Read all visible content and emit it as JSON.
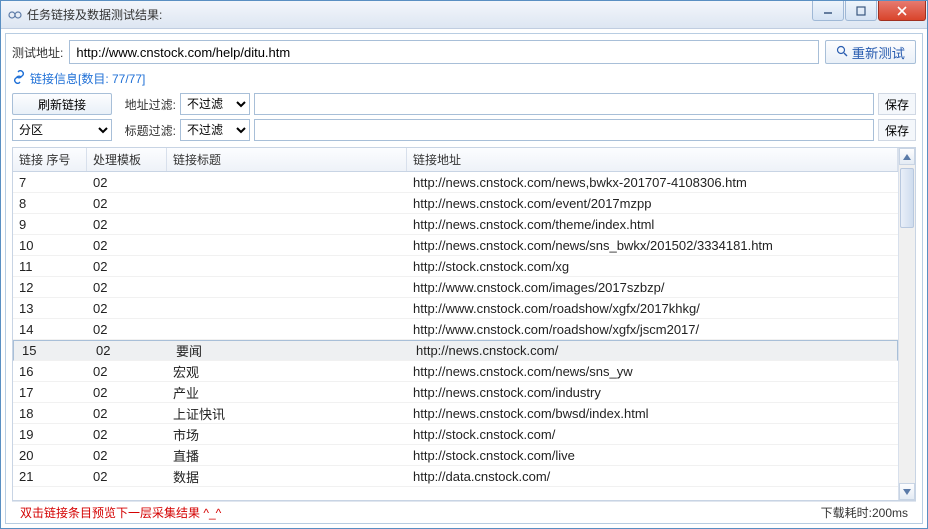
{
  "window": {
    "title": "任务链接及数据测试结果:"
  },
  "toolbar": {
    "test_url_label": "测试地址:",
    "test_url_value": "http://www.cnstock.com/help/ditu.htm",
    "retest_label": "重新测试"
  },
  "linkinfo": {
    "text": "链接信息[数目: 77/77]"
  },
  "filters": {
    "refresh_label": "刷新链接",
    "addr_filter_label": "地址过滤:",
    "title_filter_label": "标题过滤:",
    "no_filter_option": "不过滤",
    "partition_option": "分区",
    "addr_filter_value": "",
    "title_filter_value": "",
    "save_label": "保存"
  },
  "table": {
    "columns": {
      "seq": "链接 序号",
      "tmpl": "处理模板",
      "title": "链接标题",
      "url": "链接地址"
    },
    "rows": [
      {
        "seq": "7",
        "tmpl": "02",
        "title": "",
        "url": "http://news.cnstock.com/news,bwkx-201707-4108306.htm"
      },
      {
        "seq": "8",
        "tmpl": "02",
        "title": "",
        "url": "http://news.cnstock.com/event/2017mzpp"
      },
      {
        "seq": "9",
        "tmpl": "02",
        "title": "",
        "url": "http://news.cnstock.com/theme/index.html"
      },
      {
        "seq": "10",
        "tmpl": "02",
        "title": "",
        "url": "http://news.cnstock.com/news/sns_bwkx/201502/3334181.htm"
      },
      {
        "seq": "11",
        "tmpl": "02",
        "title": "",
        "url": "http://stock.cnstock.com/xg"
      },
      {
        "seq": "12",
        "tmpl": "02",
        "title": "",
        "url": "http://www.cnstock.com/images/2017szbzp/"
      },
      {
        "seq": "13",
        "tmpl": "02",
        "title": "",
        "url": "http://www.cnstock.com/roadshow/xgfx/2017khkg/"
      },
      {
        "seq": "14",
        "tmpl": "02",
        "title": "",
        "url": "http://www.cnstock.com/roadshow/xgfx/jscm2017/"
      },
      {
        "seq": "15",
        "tmpl": "02",
        "title": "要闻",
        "url": "http://news.cnstock.com/",
        "selected": true
      },
      {
        "seq": "16",
        "tmpl": "02",
        "title": "宏观",
        "url": "http://news.cnstock.com/news/sns_yw"
      },
      {
        "seq": "17",
        "tmpl": "02",
        "title": "产业",
        "url": "http://news.cnstock.com/industry"
      },
      {
        "seq": "18",
        "tmpl": "02",
        "title": "上证快讯",
        "url": "http://news.cnstock.com/bwsd/index.html"
      },
      {
        "seq": "19",
        "tmpl": "02",
        "title": "市场",
        "url": "http://stock.cnstock.com/"
      },
      {
        "seq": "20",
        "tmpl": "02",
        "title": "直播",
        "url": "http://stock.cnstock.com/live"
      },
      {
        "seq": "21",
        "tmpl": "02",
        "title": "数据",
        "url": "http://data.cnstock.com/"
      }
    ]
  },
  "footer": {
    "hint": "双击链接条目预览下一层采集结果 ^_^",
    "time_label": "下载耗时:",
    "time_value": "200ms"
  }
}
